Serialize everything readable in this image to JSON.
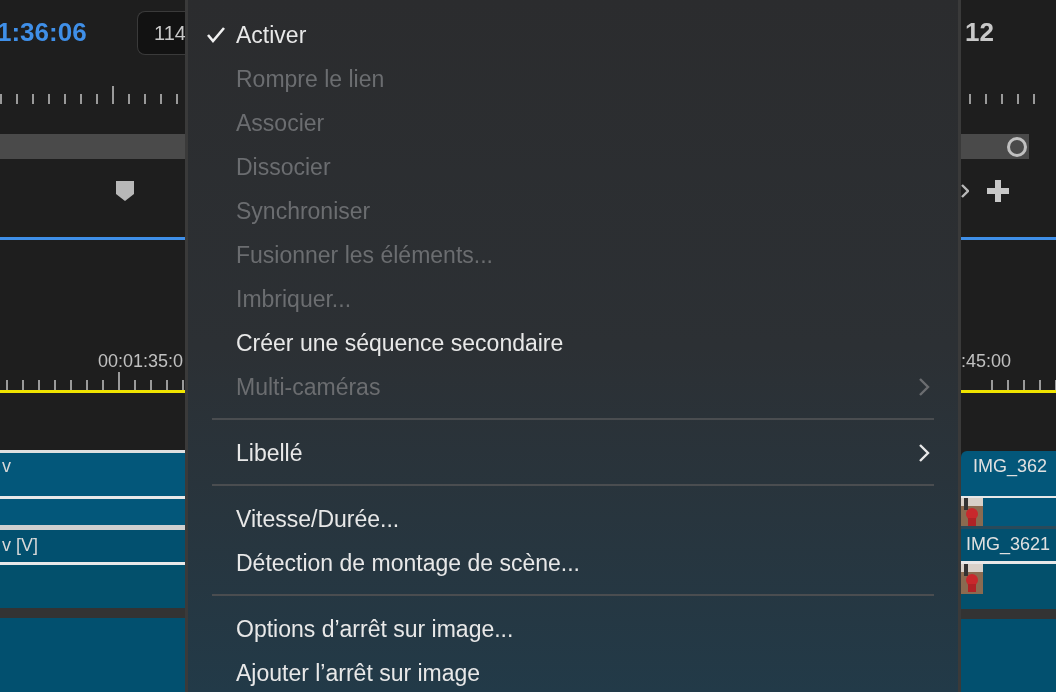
{
  "timecode": "1:36:06",
  "frame_field": "114",
  "right_number": "12",
  "ruler_left_label": "00:01:35:0",
  "ruler_right_label": ":45:00",
  "clips_left": [
    "v",
    "v [V]"
  ],
  "clips_right": [
    "IMG_362",
    "IMG_3621"
  ],
  "menu": [
    [
      {
        "label": "Activer",
        "checked": true,
        "disabled": false,
        "submenu": false
      },
      {
        "label": "Rompre le lien",
        "checked": false,
        "disabled": true,
        "submenu": false
      },
      {
        "label": "Associer",
        "checked": false,
        "disabled": true,
        "submenu": false
      },
      {
        "label": "Dissocier",
        "checked": false,
        "disabled": true,
        "submenu": false
      },
      {
        "label": "Synchroniser",
        "checked": false,
        "disabled": true,
        "submenu": false
      },
      {
        "label": "Fusionner les éléments...",
        "checked": false,
        "disabled": true,
        "submenu": false
      },
      {
        "label": "Imbriquer...",
        "checked": false,
        "disabled": true,
        "submenu": false
      },
      {
        "label": "Créer une séquence secondaire",
        "checked": false,
        "disabled": false,
        "submenu": false
      },
      {
        "label": "Multi-caméras",
        "checked": false,
        "disabled": true,
        "submenu": true
      }
    ],
    [
      {
        "label": "Libellé",
        "checked": false,
        "disabled": false,
        "submenu": true
      }
    ],
    [
      {
        "label": "Vitesse/Durée...",
        "checked": false,
        "disabled": false,
        "submenu": false
      },
      {
        "label": "Détection de montage de scène...",
        "checked": false,
        "disabled": false,
        "submenu": false
      }
    ],
    [
      {
        "label": "Options d’arrêt sur image...",
        "checked": false,
        "disabled": false,
        "submenu": false
      },
      {
        "label": "Ajouter l’arrêt sur image",
        "checked": false,
        "disabled": false,
        "submenu": false
      }
    ]
  ]
}
